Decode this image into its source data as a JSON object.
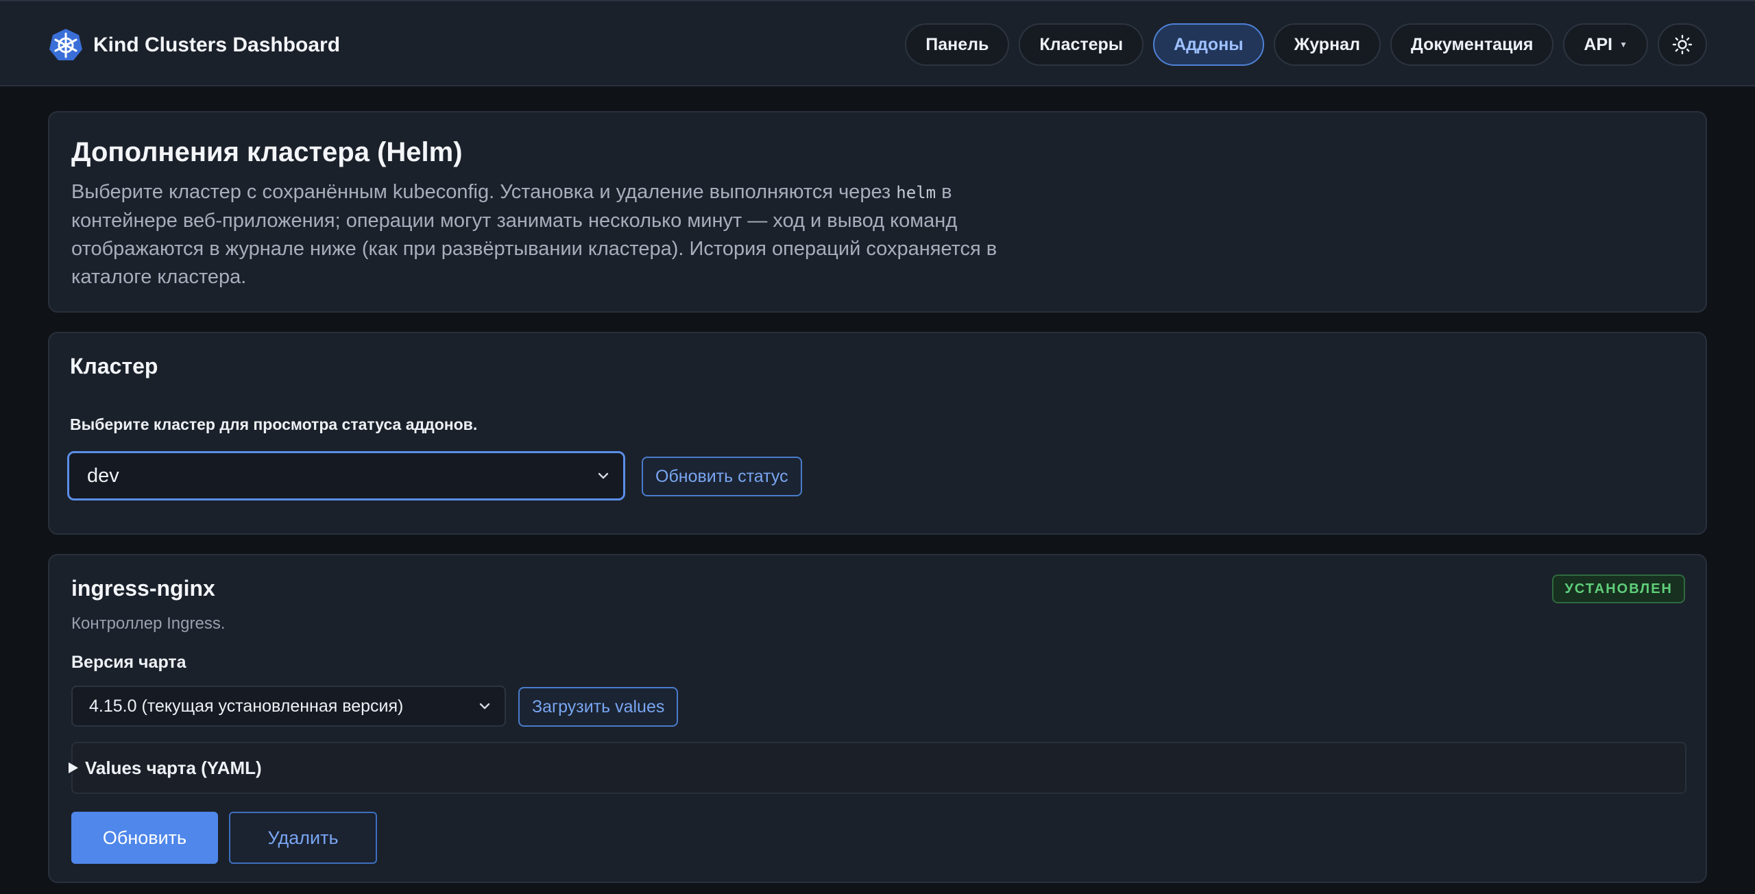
{
  "app": {
    "title": "Kind Clusters Dashboard"
  },
  "nav": {
    "items": [
      {
        "label": "Панель"
      },
      {
        "label": "Кластеры"
      },
      {
        "label": "Аддоны",
        "active": true
      },
      {
        "label": "Журнал"
      },
      {
        "label": "Документация"
      },
      {
        "label": "API"
      }
    ],
    "theme_icon": "sun-icon"
  },
  "intro": {
    "title": "Дополнения кластера (Helm)",
    "text_before": "Выберите кластер с сохранённым kubeconfig. Установка и удаление выполняются через ",
    "code": "helm",
    "text_after": " в контейнере веб-приложения; операции могут занимать несколько минут — ход и вывод команд отображаются в журнале ниже (как при развёртывании кластера). История операций сохраняется в каталоге кластера."
  },
  "cluster": {
    "title": "Кластер",
    "select_label": "Выберите кластер для просмотра статуса аддонов.",
    "selected": "dev",
    "refresh_label": "Обновить статус"
  },
  "addon": {
    "name": "ingress-nginx",
    "status": "УСТАНОВЛЕН",
    "description": "Контроллер Ingress.",
    "version_label": "Версия чарта",
    "version_selected": "4.15.0 (текущая установленная версия)",
    "load_values_label": "Загрузить values",
    "values_toggle": "Values чарта (YAML)",
    "update_label": "Обновить",
    "delete_label": "Удалить"
  },
  "colors": {
    "accent": "#4f87ea",
    "background": "#0f1217",
    "card": "#1b212b",
    "status_ok": "#5fcf7a"
  }
}
